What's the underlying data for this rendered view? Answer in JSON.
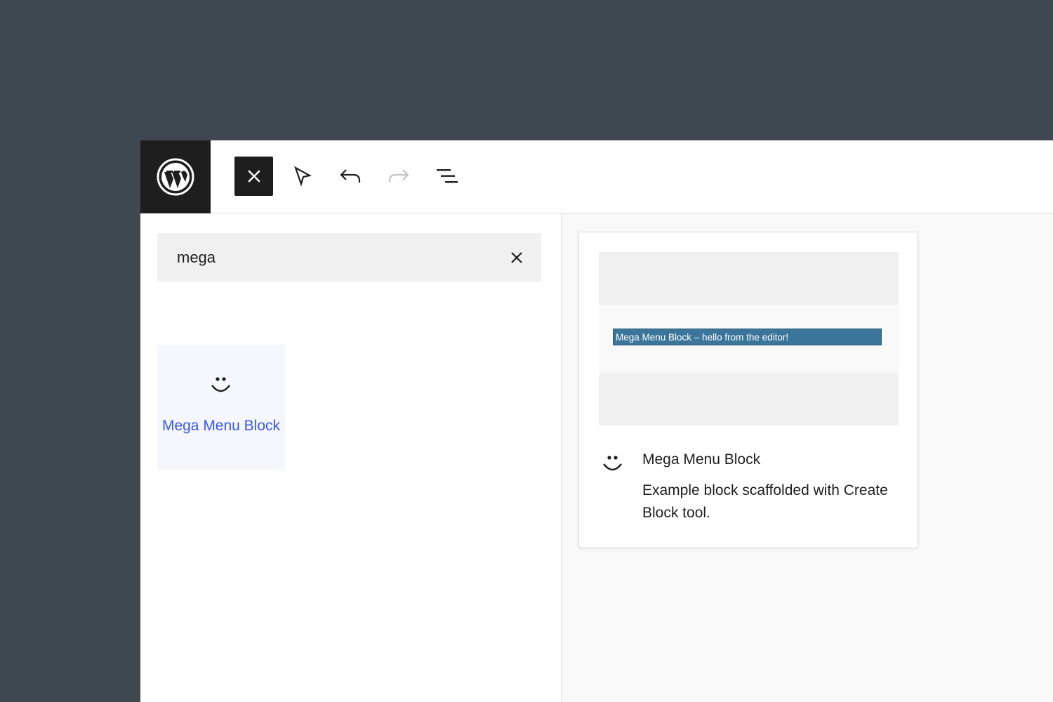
{
  "toolbar": {
    "logo_icon": "wordpress-logo-icon",
    "close_icon": "close-icon",
    "select_icon": "select-tool-icon",
    "undo_icon": "undo-icon",
    "redo_icon": "redo-icon",
    "outline_icon": "list-view-icon"
  },
  "inserter": {
    "search": {
      "value": "mega",
      "placeholder": "Search"
    },
    "blocks": [
      {
        "label": "Mega Menu Block",
        "icon": "smiley-icon"
      }
    ]
  },
  "preview": {
    "demo_text": "Mega Menu Block – hello from the editor!",
    "title": "Mega Menu Block",
    "description": "Example block scaffolded with Create Block tool.",
    "icon": "smiley-icon"
  },
  "colors": {
    "background": "#3f4750",
    "accent": "#3858e9",
    "dark": "#1e1e1e",
    "demo_bar": "#3b7599"
  }
}
